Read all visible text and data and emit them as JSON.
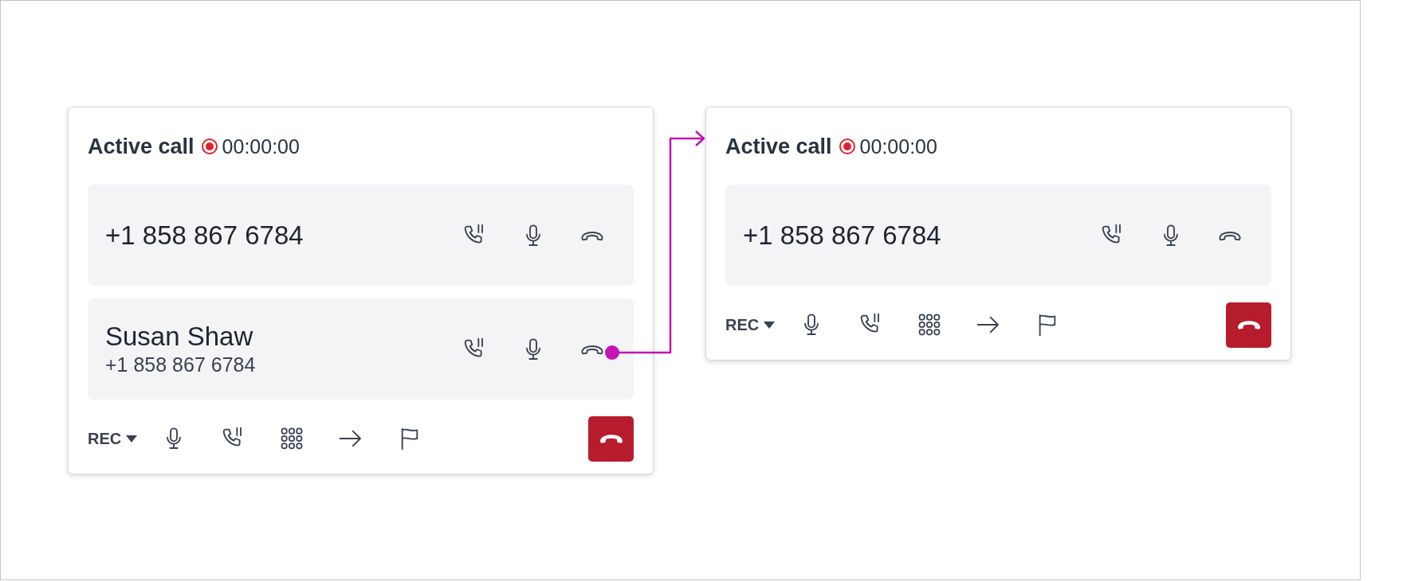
{
  "cards": [
    {
      "title": "Active call",
      "recording": true,
      "timer": "00:00:00",
      "calls": [
        {
          "primary": "+1 858 867 6784"
        },
        {
          "primary": "Susan Shaw",
          "secondary": "+1 858 867 6784"
        }
      ],
      "rec_label": "REC"
    },
    {
      "title": "Active call",
      "recording": true,
      "timer": "00:00:00",
      "calls": [
        {
          "primary": "+1 858 867 6784"
        }
      ],
      "rec_label": "REC"
    }
  ]
}
